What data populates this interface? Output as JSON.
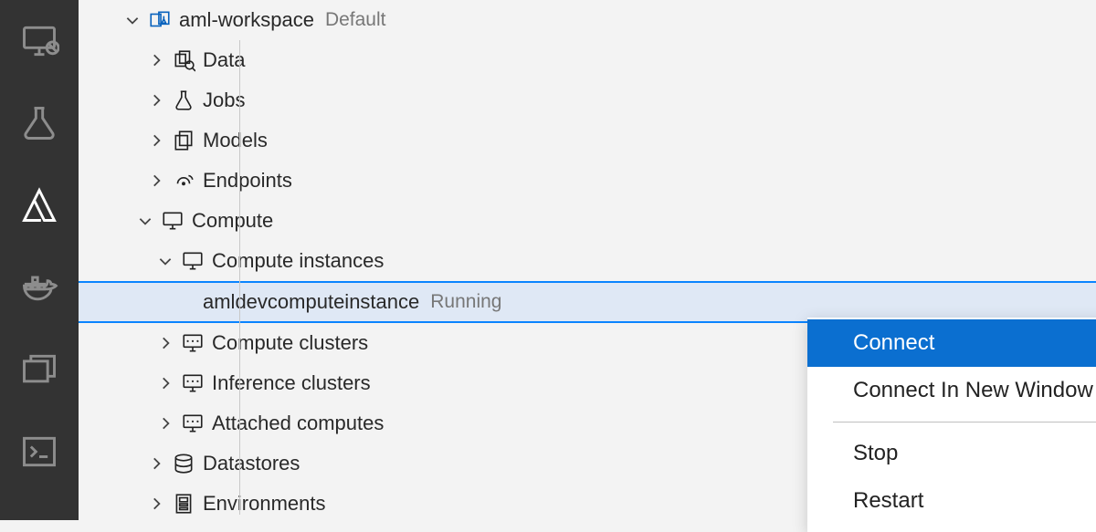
{
  "workspace": {
    "name": "aml-workspace",
    "badge": "Default"
  },
  "tree": {
    "data": "Data",
    "jobs": "Jobs",
    "models": "Models",
    "endpoints": "Endpoints",
    "compute": "Compute",
    "compute_instances": "Compute instances",
    "instance_name": "amldevcomputeinstance",
    "instance_status": "Running",
    "compute_clusters": "Compute clusters",
    "inference_clusters": "Inference clusters",
    "attached_computes": "Attached computes",
    "datastores": "Datastores",
    "environments": "Environments"
  },
  "context_menu": {
    "connect": "Connect",
    "connect_new_window": "Connect In New Window",
    "stop": "Stop",
    "restart": "Restart"
  }
}
